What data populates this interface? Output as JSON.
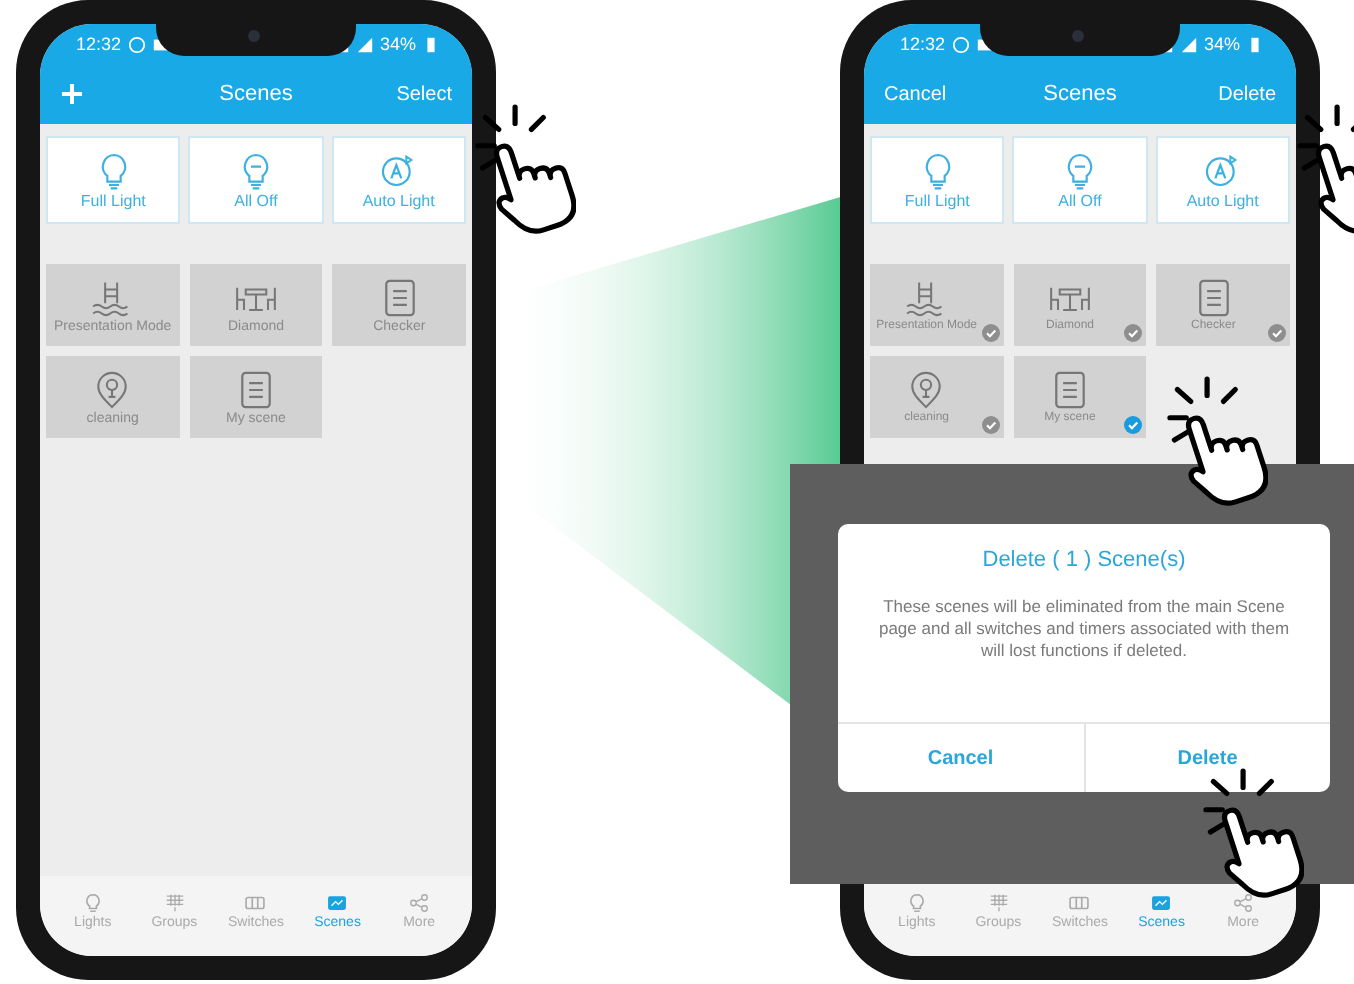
{
  "phones": [
    {
      "status": {
        "time": "12:32",
        "battery": "34%"
      },
      "header": {
        "title": "Scenes",
        "action": "Select"
      },
      "quick_scenes": [
        {
          "label": "Full Light"
        },
        {
          "label": "All Off"
        },
        {
          "label": "Auto Light"
        }
      ],
      "scenes": [
        {
          "label": "Presentation Mode"
        },
        {
          "label": "Diamond"
        },
        {
          "label": "Checker"
        },
        {
          "label": "cleaning"
        },
        {
          "label": "My scene"
        }
      ],
      "tabs": [
        {
          "label": "Lights",
          "selected": false
        },
        {
          "label": "Groups",
          "selected": false
        },
        {
          "label": "Switches",
          "selected": false
        },
        {
          "label": "Scenes",
          "selected": true
        },
        {
          "label": "More",
          "selected": false
        }
      ]
    },
    {
      "status": {
        "time": "12:32",
        "battery": "34%"
      },
      "header": {
        "leading": "Cancel",
        "title": "Scenes",
        "action": "Delete"
      },
      "quick_scenes": [
        {
          "label": "Full Light"
        },
        {
          "label": "All Off"
        },
        {
          "label": "Auto Light"
        }
      ],
      "scenes": [
        {
          "label": "Presentation Mode",
          "selected": false
        },
        {
          "label": "Diamond",
          "selected": false
        },
        {
          "label": "Checker",
          "selected": false
        },
        {
          "label": "cleaning",
          "selected": false
        },
        {
          "label": "My scene",
          "selected": true
        }
      ],
      "tabs": [
        {
          "label": "Lights",
          "selected": false
        },
        {
          "label": "Groups",
          "selected": false
        },
        {
          "label": "Switches",
          "selected": false
        },
        {
          "label": "Scenes",
          "selected": true
        },
        {
          "label": "More",
          "selected": false
        }
      ]
    }
  ],
  "dialog": {
    "title": "Delete ( 1 ) Scene(s)",
    "message": "These scenes will be eliminated from the main Scene page and all switches and timers associated with them will lost functions if deleted.",
    "buttons": [
      "Cancel",
      "Delete"
    ]
  }
}
